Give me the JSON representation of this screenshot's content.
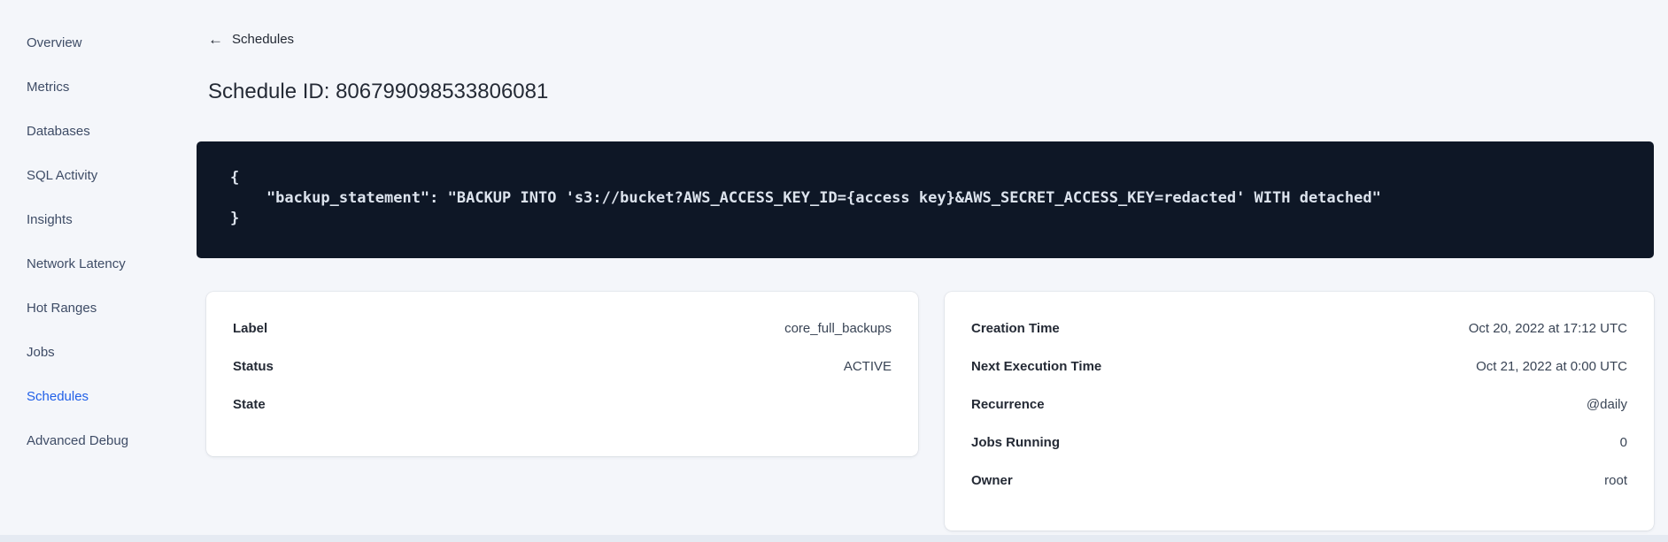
{
  "colors": {
    "active_link": "#2160e8",
    "code_background": "#0e1726",
    "page_background": "#f4f6fa"
  },
  "sidebar": {
    "items": [
      {
        "label": "Overview",
        "active": false
      },
      {
        "label": "Metrics",
        "active": false
      },
      {
        "label": "Databases",
        "active": false
      },
      {
        "label": "SQL Activity",
        "active": false
      },
      {
        "label": "Insights",
        "active": false
      },
      {
        "label": "Network Latency",
        "active": false
      },
      {
        "label": "Hot Ranges",
        "active": false
      },
      {
        "label": "Jobs",
        "active": false
      },
      {
        "label": "Schedules",
        "active": true
      },
      {
        "label": "Advanced Debug",
        "active": false
      }
    ]
  },
  "header": {
    "back_icon": "←",
    "back_label": "Schedules",
    "title": "Schedule ID: 806799098533806081"
  },
  "code_block": {
    "lines": [
      "{",
      "    \"backup_statement\": \"BACKUP INTO 's3://bucket?AWS_ACCESS_KEY_ID={access key}&AWS_SECRET_ACCESS_KEY=redacted' WITH detached\"",
      "}"
    ]
  },
  "details_card": {
    "rows": [
      {
        "label": "Label",
        "value": "core_full_backups"
      },
      {
        "label": "Status",
        "value": "ACTIVE"
      },
      {
        "label": "State",
        "value": ""
      }
    ]
  },
  "schedule_card": {
    "rows": [
      {
        "label": "Creation Time",
        "value": "Oct 20, 2022 at 17:12 UTC"
      },
      {
        "label": "Next Execution Time",
        "value": "Oct 21, 2022 at 0:00 UTC"
      },
      {
        "label": "Recurrence",
        "value": "@daily"
      },
      {
        "label": "Jobs Running",
        "value": "0"
      },
      {
        "label": "Owner",
        "value": "root"
      }
    ]
  }
}
